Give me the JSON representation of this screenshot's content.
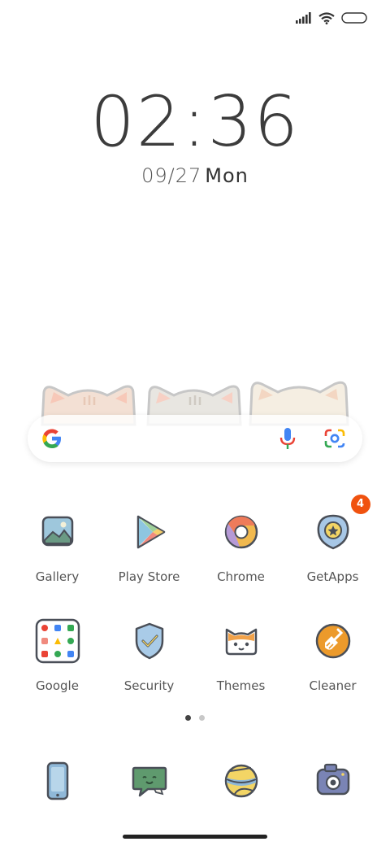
{
  "status": {
    "icons": [
      "signal-icon",
      "wifi-icon",
      "battery-icon"
    ]
  },
  "clock": {
    "time": "02:36",
    "date": "09/27",
    "weekday": "Mon"
  },
  "search_bar": {
    "icons": [
      "google-icon",
      "mic-icon",
      "lens-icon"
    ]
  },
  "apps_row1": [
    {
      "label": "Gallery",
      "icon": "gallery-icon"
    },
    {
      "label": "Play Store",
      "icon": "play-store-icon"
    },
    {
      "label": "Chrome",
      "icon": "chrome-icon"
    },
    {
      "label": "GetApps",
      "icon": "getapps-icon",
      "badge": "4"
    }
  ],
  "apps_row2": [
    {
      "label": "Google",
      "icon": "google-folder-icon"
    },
    {
      "label": "Security",
      "icon": "security-icon"
    },
    {
      "label": "Themes",
      "icon": "themes-icon"
    },
    {
      "label": "Cleaner",
      "icon": "cleaner-icon"
    }
  ],
  "pager": {
    "pages": 2,
    "current": 1
  },
  "dock": [
    {
      "icon": "phone-icon"
    },
    {
      "icon": "messages-icon"
    },
    {
      "icon": "browser-icon"
    },
    {
      "icon": "camera-icon"
    }
  ],
  "colors": {
    "badge": "#f0520f",
    "cleaner": "#ec9a2b",
    "icon_stroke": "#4a4f58"
  }
}
